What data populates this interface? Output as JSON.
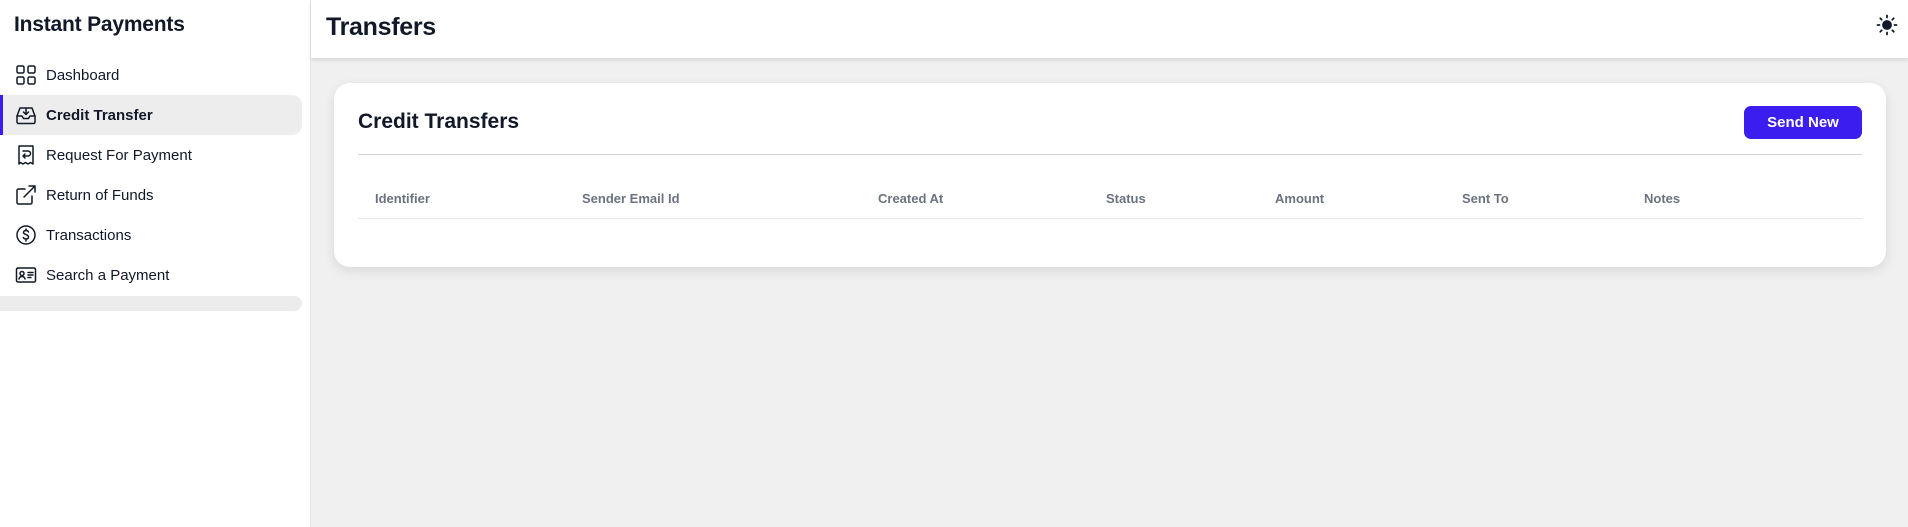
{
  "sidebar": {
    "title": "Instant Payments",
    "items": [
      {
        "label": "Dashboard",
        "icon": "grid-icon"
      },
      {
        "label": "Credit Transfer",
        "icon": "inbox-icon",
        "active": true
      },
      {
        "label": "Request For Payment",
        "icon": "receipt-return-icon"
      },
      {
        "label": "Return of Funds",
        "icon": "external-link-icon"
      },
      {
        "label": "Transactions",
        "icon": "dollar-circle-icon"
      },
      {
        "label": "Search a Payment",
        "icon": "id-card-icon"
      }
    ]
  },
  "header": {
    "title": "Transfers",
    "theme_icon": "sun-icon"
  },
  "card": {
    "title": "Credit Transfers",
    "send_label": "Send New",
    "columns": [
      "Identifier",
      "Sender Email Id",
      "Created At",
      "Status",
      "Amount",
      "Sent To",
      "Notes"
    ],
    "rows": []
  },
  "colors": {
    "accent": "#3b1df0",
    "background": "#f0f0f0",
    "active_item": "#ededed"
  }
}
